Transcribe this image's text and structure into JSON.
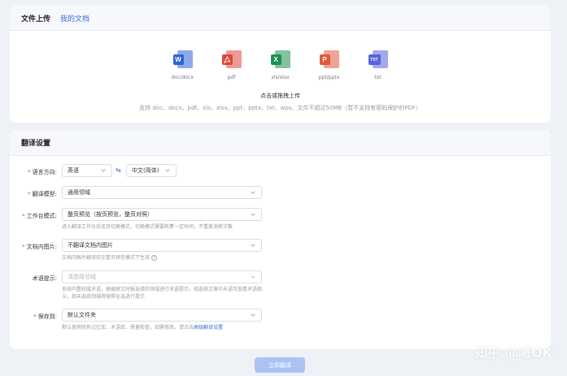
{
  "tabs": {
    "upload": "文件上传",
    "my_docs": "我的文档"
  },
  "file_types": [
    {
      "label": "doc/docx",
      "badge": "W",
      "color": "#2f64d6",
      "icon": "word-icon"
    },
    {
      "label": "pdf",
      "badge": "",
      "color": "#e0473a",
      "icon": "pdf-icon"
    },
    {
      "label": "xls/xlsx",
      "badge": "X",
      "color": "#1e8f4e",
      "icon": "excel-icon"
    },
    {
      "label": "ppt/pptx",
      "badge": "P",
      "color": "#e25a3a",
      "icon": "powerpoint-icon"
    },
    {
      "label": "txt",
      "badge": "TXT",
      "color": "#5a63d8",
      "icon": "text-file-icon"
    }
  ],
  "upload": {
    "title": "点击或拖拽上传",
    "hint": "支持 doc、docx、pdf、xls、xlsx、ppt、pptx、txt、wps、文件不超过50MB（暂不支持有密码保护的PDF）"
  },
  "settings": {
    "title": "翻译设置",
    "language": {
      "label": "语言方向:",
      "source": "英语",
      "target": "中文(简体)"
    },
    "model": {
      "label": "翻译模型:",
      "value": "通用领域"
    },
    "workspace": {
      "label": "工作台模式:",
      "value": "整页预览（按页预览，整页对照）",
      "help": "进入翻译工作台后支持切换模式，切换模式需要耗费一定时间，不重复消耗字数"
    },
    "images": {
      "label": "文档内图片:",
      "value": "不翻译文档内图片",
      "help": "文档内图片翻译仅在整页预览模式下生效"
    },
    "terms": {
      "label": "术语提示:",
      "placeholder": "请选择领域",
      "help": "系统内置权威术语，根据原文时报选择的领域进行术语提示，如选择文章中未语可查看术语释义，如未选择领域将按照全选进行提示"
    },
    "save": {
      "label": "保存到:",
      "value": "默认文件夹",
      "help_prefix": "默认使用所有记忆库、术语库、质量检查，如需修改，请点击",
      "help_link": "高级翻译设置"
    }
  },
  "submit_label": "立即翻译",
  "watermark": "知乎 @嗯OK"
}
